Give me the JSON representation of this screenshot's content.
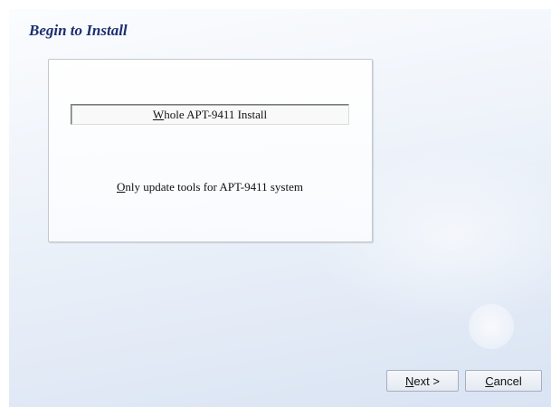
{
  "header": {
    "title": "Begin to Install"
  },
  "options": {
    "whole_mnemonic": "W",
    "whole_rest": "hole APT-9411 Install",
    "update_mnemonic": "O",
    "update_rest": "nly update tools for APT-9411 system"
  },
  "buttons": {
    "next_mnemonic": "N",
    "next_rest": "ext >",
    "cancel_mnemonic": "C",
    "cancel_rest": "ancel"
  },
  "colors": {
    "title": "#1c2f70",
    "background_top": "#fbfcfe",
    "background_bottom": "#d9e3f3"
  }
}
